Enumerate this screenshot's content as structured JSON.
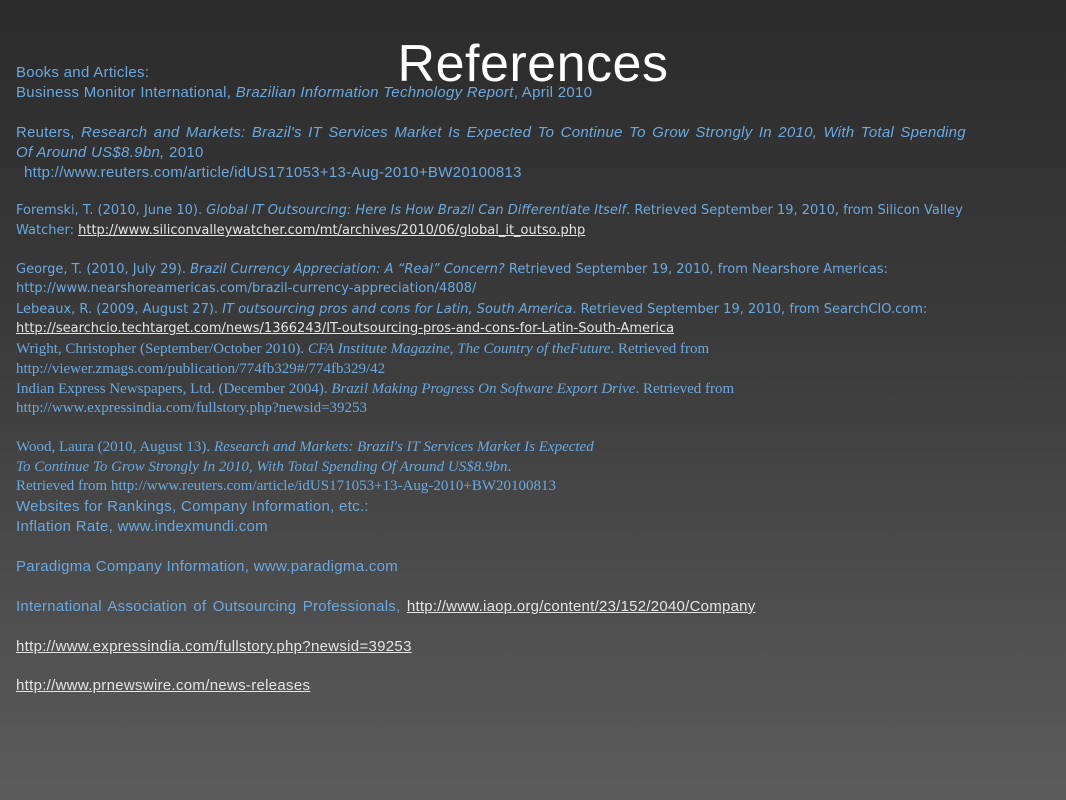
{
  "title": "References",
  "section_books": "Books and Articles:",
  "bmi": {
    "a": "Business Monitor International, ",
    "b": "Brazilian Information Technology Report",
    "c": ", April 2010"
  },
  "reuters": {
    "a": "Reuters, ",
    "b": "Research and Markets: Brazil's IT Services Market Is Expected To Continue To Grow Strongly In 2010, With Total Spending",
    "c": "Of Around US$8.9bn,",
    "d": " 2010",
    "url": "http://www.reuters.com/article/idUS171053+13-Aug-2010+BW20100813"
  },
  "foremski": {
    "a": "Foremski, T. (2010, June 10). ",
    "b": "Global IT Outsourcing: Here Is How Brazil Can Differentiate Itself",
    "c": ". Retrieved September 19, 2010, from Silicon Valley",
    "d": "Watcher: ",
    "url": "http://www.siliconvalleywatcher.com/mt/archives/2010/06/global_it_outso.php"
  },
  "george": {
    "a": "George, T. (2010, July 29). ",
    "b": "Brazil Currency Appreciation: A “Real” Concern?",
    "c": " Retrieved September 19, 2010, from Nearshore Americas:",
    "url": "http://www.nearshoreamericas.com/brazil-currency-appreciation/4808/"
  },
  "lebeaux": {
    "a": "Lebeaux, R. (2009, August 27). ",
    "b": "IT outsourcing pros and cons for Latin, South America",
    "c": ". Retrieved September 19, 2010, from SearchCIO.com:",
    "url": "http://searchcio.techtarget.com/news/1366243/IT-outsourcing-pros-and-cons-for-Latin-South-America"
  },
  "wright": {
    "a": "Wright, Christopher (September/October 2010). ",
    "b": "CFA Institute Magazine, The Country of theFuture",
    "c": ". Retrieved from",
    "url": "http://viewer.zmags.com/publication/774fb329#/774fb329/42"
  },
  "indian": {
    "a": "Indian Express Newspapers, Ltd. (December 2004). ",
    "b": "Brazil Making Progress On Software Export Drive",
    "c": ". Retrieved from",
    "url": "http://www.expressindia.com/fullstory.php?newsid=39253"
  },
  "wood": {
    "a": "Wood, Laura (2010, August 13). ",
    "b": "Research and Markets: Brazil's IT Services Market Is Expected",
    "c": "To Continue To Grow Strongly In 2010, With Total Spending Of Around US$8.9bn",
    "d": ".",
    "e": "Retrieved from http://www.reuters.com/article/idUS171053+13-Aug-2010+BW20100813"
  },
  "section_websites": " Websites for Rankings, Company Information, etc.:",
  "inflation": "Inflation Rate, www.indexmundi.com",
  "paradigma": "Paradigma Company Information, www.paradigma.com",
  "iaop": {
    "a": "International Association of Outsourcing Professionals, ",
    "url": "http://www.iaop.org/content/23/152/2040/Company"
  },
  "link_expressindia": "http://www.expressindia.com/fullstory.php?newsid=39253",
  "link_prnewswire": "http://www.prnewswire.com/news-releases",
  "colors": {
    "text": "#6aa9e0",
    "link": "#e4e4e4",
    "title": "#ffffff"
  }
}
